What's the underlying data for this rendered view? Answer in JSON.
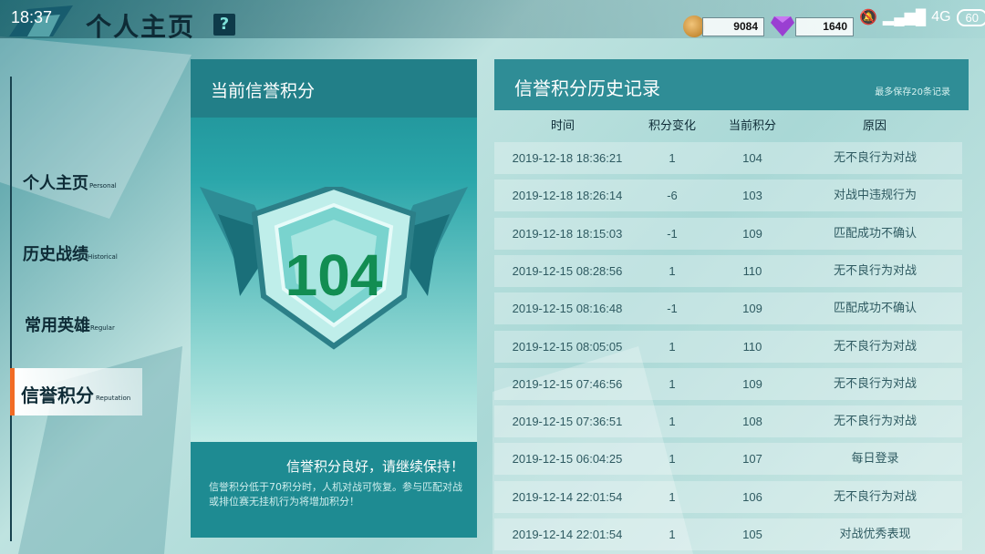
{
  "status_bar": {
    "time": "18:37",
    "network": "4G",
    "battery": "60"
  },
  "header": {
    "title": "个人主页",
    "help_label": "?",
    "coins": "9084",
    "gems": "1640"
  },
  "nav": {
    "items": [
      {
        "label": "个人主页",
        "sub": "Personal"
      },
      {
        "label": "历史战绩",
        "sub": "Historical"
      },
      {
        "label": "常用英雄",
        "sub": "Regular"
      },
      {
        "label": "信誉积分",
        "sub": "Reputation"
      }
    ],
    "active_index": 3
  },
  "score_panel": {
    "title": "当前信誉积分",
    "score": "104",
    "status_text": "信誉积分良好，请继续保持！",
    "note": "信誉积分低于70积分时，人机对战可恢复。参与匹配对战或排位赛无挂机行为将增加积分！"
  },
  "history": {
    "title": "信誉积分历史记录",
    "limit_note": "最多保存20条记录",
    "columns": [
      "时间",
      "积分变化",
      "当前积分",
      "原因"
    ],
    "rows": [
      {
        "time": "2019-12-18 18:36:21",
        "change": "1",
        "current": "104",
        "reason": "无不良行为对战"
      },
      {
        "time": "2019-12-18 18:26:14",
        "change": "-6",
        "current": "103",
        "reason": "对战中违规行为"
      },
      {
        "time": "2019-12-18 18:15:03",
        "change": "-1",
        "current": "109",
        "reason": "匹配成功不确认"
      },
      {
        "time": "2019-12-15 08:28:56",
        "change": "1",
        "current": "110",
        "reason": "无不良行为对战"
      },
      {
        "time": "2019-12-15 08:16:48",
        "change": "-1",
        "current": "109",
        "reason": "匹配成功不确认"
      },
      {
        "time": "2019-12-15 08:05:05",
        "change": "1",
        "current": "110",
        "reason": "无不良行为对战"
      },
      {
        "time": "2019-12-15 07:46:56",
        "change": "1",
        "current": "109",
        "reason": "无不良行为对战"
      },
      {
        "time": "2019-12-15 07:36:51",
        "change": "1",
        "current": "108",
        "reason": "无不良行为对战"
      },
      {
        "time": "2019-12-15 06:04:25",
        "change": "1",
        "current": "107",
        "reason": "每日登录"
      },
      {
        "time": "2019-12-14 22:01:54",
        "change": "1",
        "current": "106",
        "reason": "无不良行为对战"
      },
      {
        "time": "2019-12-14 22:01:54",
        "change": "1",
        "current": "105",
        "reason": "对战优秀表现"
      }
    ]
  }
}
